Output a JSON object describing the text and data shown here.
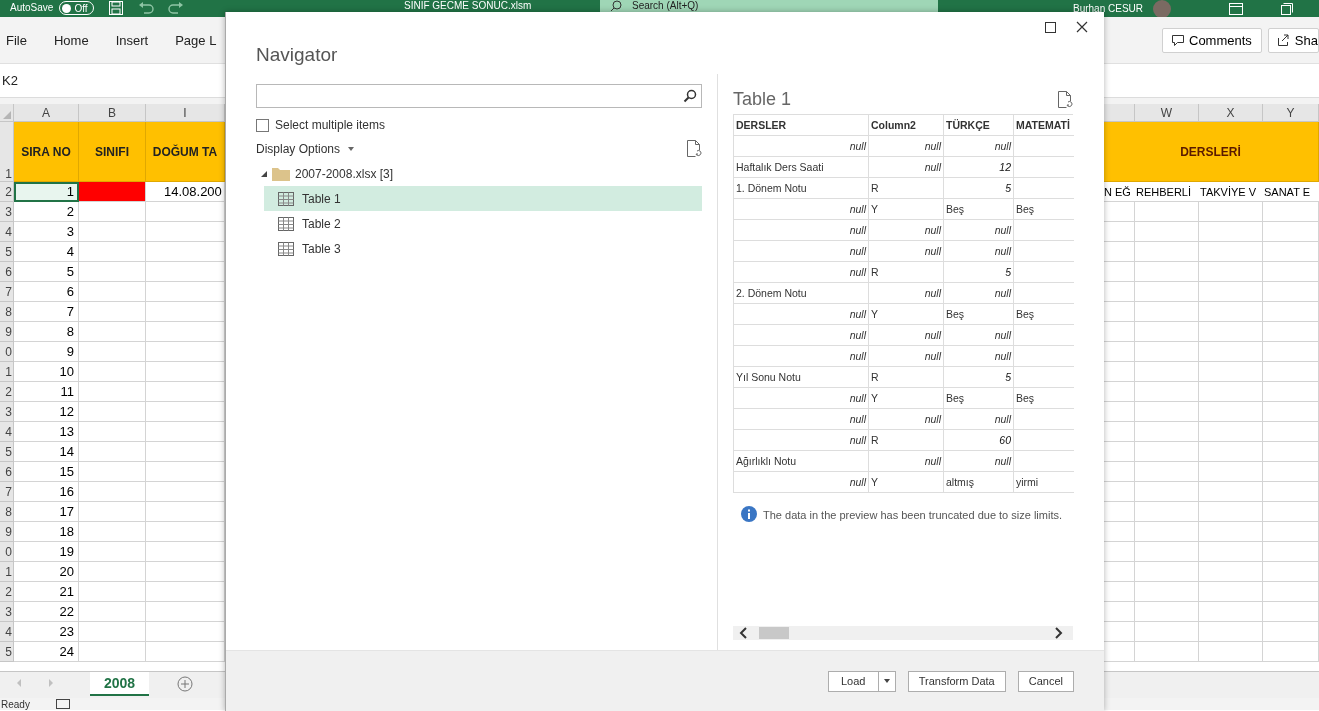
{
  "title_bar": {
    "autosave_label": "AutoSave",
    "autosave_toggle": {
      "label": "Off",
      "on": false
    },
    "file_name": "SINIF GECME SONUC.xlsm",
    "search": {
      "placeholder": "Search (Alt+Q)"
    },
    "user_name": "Burhan CESUR"
  },
  "ribbon": {
    "tabs": [
      {
        "label": "File",
        "selected": false
      },
      {
        "label": "Home",
        "selected": false
      },
      {
        "label": "Insert",
        "selected": false
      },
      {
        "label": "Page L",
        "selected": false
      }
    ],
    "comments_button": "Comments",
    "share_button": "Sha"
  },
  "name_box": "K2",
  "sheet": {
    "left_columns": [
      "A",
      "B",
      "I"
    ],
    "right_columns": [
      "W",
      "X",
      "Y"
    ],
    "header_row": "1",
    "header_left": [
      "SIRA NO",
      "SINIFI",
      "DOĞUM TA"
    ],
    "header_right": "DERSLERİ",
    "rows": [
      {
        "row": "2",
        "sira_no": "1",
        "selected": true,
        "sinifi": {
          "color": "#ff0000"
        },
        "dogum": "14.08.200",
        "right": [
          "N EĞ",
          "REHBERLİ",
          "TAKVİYE V",
          "SANAT E"
        ]
      },
      {
        "row": "3",
        "sira_no": "2",
        "selected": false
      },
      {
        "row": "4",
        "sira_no": "3",
        "selected": false
      },
      {
        "row": "5",
        "sira_no": "4",
        "selected": false
      },
      {
        "row": "6",
        "sira_no": "5",
        "selected": false
      },
      {
        "row": "7",
        "sira_no": "6",
        "selected": false
      },
      {
        "row": "8",
        "sira_no": "7",
        "selected": false
      },
      {
        "row": "9",
        "sira_no": "8",
        "selected": false
      },
      {
        "row": "0",
        "sira_no": "9",
        "selected": false
      },
      {
        "row": "1",
        "sira_no": "10",
        "selected": false
      },
      {
        "row": "2",
        "sira_no": "11",
        "selected": false
      },
      {
        "row": "3",
        "sira_no": "12",
        "selected": false
      },
      {
        "row": "4",
        "sira_no": "13",
        "selected": false
      },
      {
        "row": "5",
        "sira_no": "14",
        "selected": false
      },
      {
        "row": "6",
        "sira_no": "15",
        "selected": false
      },
      {
        "row": "7",
        "sira_no": "16",
        "selected": false
      },
      {
        "row": "8",
        "sira_no": "17",
        "selected": false
      },
      {
        "row": "9",
        "sira_no": "18",
        "selected": false
      },
      {
        "row": "0",
        "sira_no": "19",
        "selected": false
      },
      {
        "row": "1",
        "sira_no": "20",
        "selected": false
      },
      {
        "row": "2",
        "sira_no": "21",
        "selected": false
      },
      {
        "row": "3",
        "sira_no": "22",
        "selected": false
      },
      {
        "row": "4",
        "sira_no": "23",
        "selected": false
      },
      {
        "row": "5",
        "sira_no": "24",
        "selected": false
      }
    ],
    "sheet_tabs": [
      {
        "label": "2008",
        "selected": true
      }
    ]
  },
  "status_bar": {
    "text": "Ready"
  },
  "navigator": {
    "title": "Navigator",
    "select_multiple": {
      "label": "Select multiple items",
      "checked": false
    },
    "display_options": "Display Options",
    "tree": [
      {
        "label": "2007-2008.xlsx [3]",
        "expanded": true,
        "children": [
          {
            "label": "Table 1",
            "selected": true
          },
          {
            "label": "Table 2",
            "selected": false
          },
          {
            "label": "Table 3",
            "selected": false
          }
        ]
      }
    ],
    "preview": {
      "title": "Table 1",
      "columns": [
        "DERSLER",
        "Column2",
        "TÜRKÇE",
        "MATEMATİ"
      ],
      "rows": [
        [
          {
            "text": "null",
            "kind": "null"
          },
          {
            "text": "null",
            "kind": "null"
          },
          {
            "text": "null",
            "kind": "null"
          }
        ],
        [
          {
            "text": "Haftalık Ders Saati",
            "kind": "text"
          },
          {
            "text": "null",
            "kind": "null"
          },
          {
            "text": "12",
            "kind": "number"
          }
        ],
        [
          {
            "text": "1. Dönem Notu",
            "kind": "text"
          },
          {
            "text": "R",
            "kind": "text"
          },
          {
            "text": "5",
            "kind": "number"
          }
        ],
        [
          {
            "text": "null",
            "kind": "null"
          },
          {
            "text": "Y",
            "kind": "text"
          },
          {
            "text": "Beş",
            "kind": "text"
          },
          {
            "text": "Beş",
            "kind": "text"
          }
        ],
        [
          {
            "text": "null",
            "kind": "null"
          },
          {
            "text": "null",
            "kind": "null"
          },
          {
            "text": "null",
            "kind": "null"
          }
        ],
        [
          {
            "text": "null",
            "kind": "null"
          },
          {
            "text": "null",
            "kind": "null"
          },
          {
            "text": "null",
            "kind": "null"
          }
        ],
        [
          {
            "text": "null",
            "kind": "null"
          },
          {
            "text": "R",
            "kind": "text"
          },
          {
            "text": "5",
            "kind": "number"
          }
        ],
        [
          {
            "text": "2. Dönem Notu",
            "kind": "text"
          },
          {
            "text": "null",
            "kind": "null"
          },
          {
            "text": "null",
            "kind": "null"
          }
        ],
        [
          {
            "text": "null",
            "kind": "null"
          },
          {
            "text": "Y",
            "kind": "text"
          },
          {
            "text": "Beş",
            "kind": "text"
          },
          {
            "text": "Beş",
            "kind": "text"
          }
        ],
        [
          {
            "text": "null",
            "kind": "null"
          },
          {
            "text": "null",
            "kind": "null"
          },
          {
            "text": "null",
            "kind": "null"
          }
        ],
        [
          {
            "text": "null",
            "kind": "null"
          },
          {
            "text": "null",
            "kind": "null"
          },
          {
            "text": "null",
            "kind": "null"
          }
        ],
        [
          {
            "text": "Yıl Sonu Notu",
            "kind": "text"
          },
          {
            "text": "R",
            "kind": "text"
          },
          {
            "text": "5",
            "kind": "number"
          }
        ],
        [
          {
            "text": "null",
            "kind": "null"
          },
          {
            "text": "Y",
            "kind": "text"
          },
          {
            "text": "Beş",
            "kind": "text"
          },
          {
            "text": "Beş",
            "kind": "text"
          }
        ],
        [
          {
            "text": "null",
            "kind": "null"
          },
          {
            "text": "null",
            "kind": "null"
          },
          {
            "text": "null",
            "kind": "null"
          }
        ],
        [
          {
            "text": "null",
            "kind": "null"
          },
          {
            "text": "R",
            "kind": "text"
          },
          {
            "text": "60",
            "kind": "number"
          }
        ],
        [
          {
            "text": "Ağırlıklı Notu",
            "kind": "text"
          },
          {
            "text": "null",
            "kind": "null"
          },
          {
            "text": "null",
            "kind": "null"
          }
        ],
        [
          {
            "text": "null",
            "kind": "null"
          },
          {
            "text": "Y",
            "kind": "text"
          },
          {
            "text": "altmış",
            "kind": "text"
          },
          {
            "text": "yirmi",
            "kind": "text"
          }
        ]
      ],
      "note": "The data in the preview has been truncated due to size limits."
    },
    "buttons": {
      "load": "Load",
      "transform": "Transform Data",
      "cancel": "Cancel"
    }
  }
}
